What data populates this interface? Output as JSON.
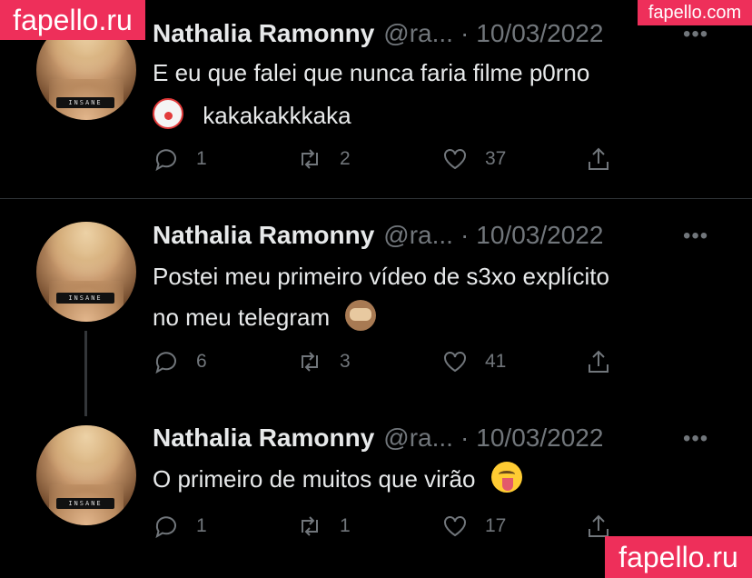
{
  "watermarks": {
    "top_left": "fapello.ru",
    "top_right": "fapello.com",
    "bottom_right": "fapello.ru"
  },
  "tweets": [
    {
      "name": "Nathalia Ramonny",
      "handle": "@ra...",
      "separator": "·",
      "date": "10/03/2022",
      "more": "•••",
      "avatar_band": "INSANE",
      "text_line1": "E eu que falei que nunca faria filme p0rno",
      "text_line2": "kakakakkkaka",
      "emoji": "clown-face-icon",
      "replies": "1",
      "retweets": "2",
      "likes": "37"
    },
    {
      "name": "Nathalia Ramonny",
      "handle": "@ra...",
      "separator": "·",
      "date": "10/03/2022",
      "more": "•••",
      "avatar_band": "INSANE",
      "text_line1": "Postei meu primeiro vídeo de s3xo explícito",
      "text_line2": "no meu telegram",
      "emoji": "see-no-evil-monkey-icon",
      "replies": "6",
      "retweets": "3",
      "likes": "41"
    },
    {
      "name": "Nathalia Ramonny",
      "handle": "@ra...",
      "separator": "·",
      "date": "10/03/2022",
      "more": "•••",
      "avatar_band": "INSANE",
      "text_line1": "O primeiro de muitos que virão",
      "emoji": "tongue-face-icon",
      "replies": "1",
      "retweets": "1",
      "likes": "17"
    }
  ],
  "colors": {
    "background": "#000000",
    "text": "#e7e9ea",
    "muted": "#71767b",
    "divider": "#2f3336",
    "watermark": "#ee2f5a"
  }
}
